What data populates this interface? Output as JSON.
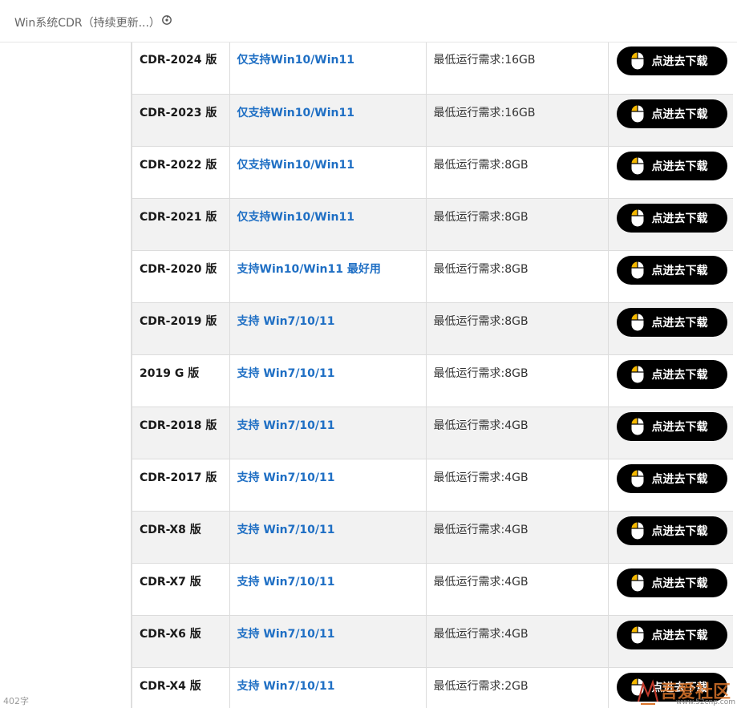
{
  "header": {
    "tab_title": "Win系统CDR（持续更新...）"
  },
  "footer": {
    "word_count": "402字"
  },
  "watermark": {
    "text": "吾爱社区",
    "url": "www.52cnp.com"
  },
  "download_label": "点进去下载",
  "colors": {
    "os_link": "#1f6fc4",
    "button_bg": "#000000",
    "mouse_yellow": "#f5b800"
  },
  "rows": [
    {
      "version": "CDR-2024 版",
      "os": "仅支持Win10/Win11",
      "requirement": "最低运行需求:16GB"
    },
    {
      "version": "CDR-2023 版",
      "os": "仅支持Win10/Win11",
      "requirement": "最低运行需求:16GB"
    },
    {
      "version": "CDR-2022 版",
      "os": "仅支持Win10/Win11",
      "requirement": "最低运行需求:8GB"
    },
    {
      "version": "CDR-2021 版",
      "os": "仅支持Win10/Win11",
      "requirement": "最低运行需求:8GB"
    },
    {
      "version": "CDR-2020 版",
      "os": "支持Win10/Win11 最好用",
      "requirement": "最低运行需求:8GB"
    },
    {
      "version": "CDR-2019 版",
      "os": "支持 Win7/10/11",
      "requirement": "最低运行需求:8GB"
    },
    {
      "version": "2019 G 版",
      "os": "支持 Win7/10/11",
      "requirement": "最低运行需求:8GB"
    },
    {
      "version": "CDR-2018 版",
      "os": "支持 Win7/10/11",
      "requirement": "最低运行需求:4GB"
    },
    {
      "version": "CDR-2017 版",
      "os": "支持 Win7/10/11",
      "requirement": "最低运行需求:4GB"
    },
    {
      "version": "CDR-X8 版",
      "os": "支持 Win7/10/11",
      "requirement": "最低运行需求:4GB"
    },
    {
      "version": "CDR-X7 版",
      "os": "支持 Win7/10/11",
      "requirement": "最低运行需求:4GB"
    },
    {
      "version": "CDR-X6 版",
      "os": "支持 Win7/10/11",
      "requirement": "最低运行需求:4GB"
    },
    {
      "version": "CDR-X4 版",
      "os": "支持 Win7/10/11",
      "requirement": "最低运行需求:2GB"
    }
  ]
}
